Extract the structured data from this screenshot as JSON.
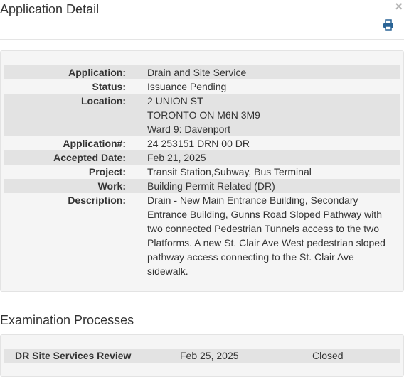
{
  "dialog": {
    "title": "Application Detail",
    "close_label": "×"
  },
  "details": [
    {
      "label": "Application:",
      "value": "Drain and Site Service"
    },
    {
      "label": "Status:",
      "value": "Issuance Pending"
    },
    {
      "label": "Location:",
      "value_lines": [
        "2 UNION ST",
        "TORONTO ON M6N 3M9",
        "Ward 9: Davenport"
      ]
    },
    {
      "label": "Application#:",
      "value": "24 253151 DRN 00 DR"
    },
    {
      "label": "Accepted Date:",
      "value": "Feb 21, 2025"
    },
    {
      "label": "Project:",
      "value": "Transit Station,Subway, Bus Terminal"
    },
    {
      "label": "Work:",
      "value": "Building Permit Related (DR)"
    },
    {
      "label": "Description:",
      "value": "Drain - New Main Entrance Building, Secondary Entrance Building, Gunns Road Sloped Pathway with two connected Pedestrian Tunnels access to the two Platforms. A new St. Clair Ave West pedestrian sloped pathway access connecting to the St. Clair Ave sidewalk."
    }
  ],
  "examination": {
    "title": "Examination Processes",
    "rows": [
      {
        "name": "DR Site Services Review",
        "date": "Feb 25, 2025",
        "status": "Closed"
      }
    ]
  },
  "icons": {
    "print": "print-icon",
    "close": "close-icon"
  }
}
